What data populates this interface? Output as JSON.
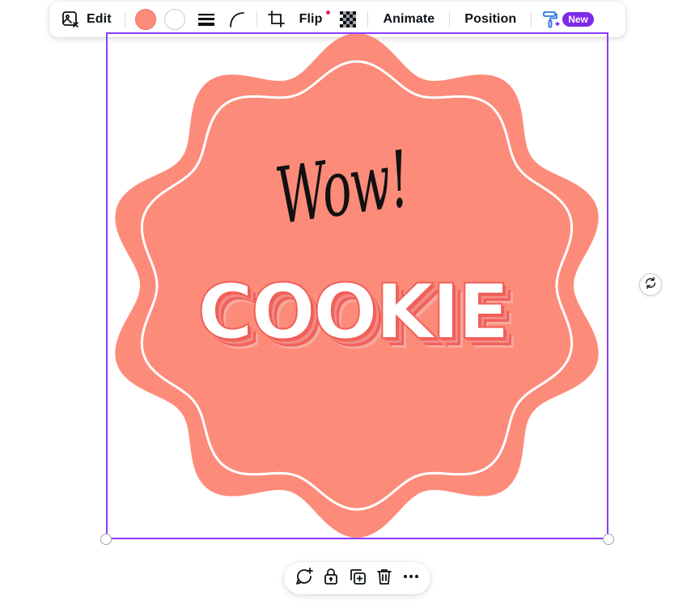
{
  "toolbar": {
    "edit_label": "Edit",
    "flip_label": "Flip",
    "animate_label": "Animate",
    "position_label": "Position",
    "new_badge": "New",
    "primary_color": "#fd8b7a",
    "secondary_color": "#ffffff"
  },
  "graphic": {
    "script_text": "Wow!",
    "title_text": "COOKIE",
    "badge_color": "#fd8b7a",
    "inner_line_color": "#ffffff",
    "text_color": "#ffffff",
    "shadow_color": "#f1605a"
  },
  "selection": {
    "border_color": "#8b3dff"
  },
  "bottom_bar": {
    "icons": [
      "comment-add-icon",
      "lock-icon",
      "duplicate-icon",
      "trash-icon",
      "more-icon"
    ]
  }
}
